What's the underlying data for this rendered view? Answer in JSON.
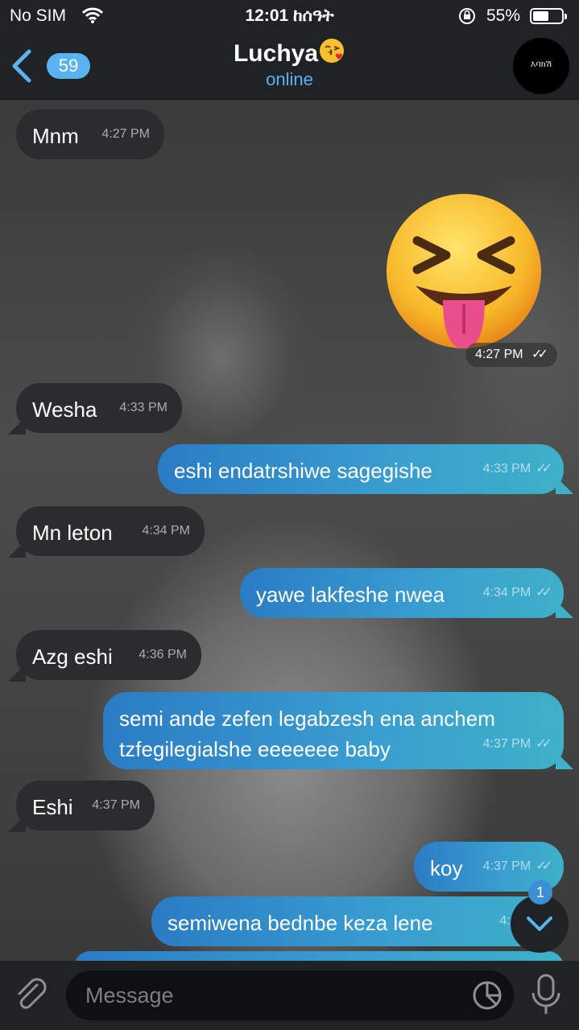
{
  "status_bar": {
    "carrier": "No SIM",
    "time": "12:01 ከሰዓት",
    "battery_percent": "55%",
    "battery_level": 0.55
  },
  "header": {
    "back_count": "59",
    "contact_name": "Luchya",
    "status": "online",
    "avatar_text": "እባክሽ"
  },
  "messages": [
    {
      "direction": "in",
      "text": "Mnm",
      "time": "4:27 PM"
    },
    {
      "direction": "out",
      "type": "sticker",
      "sticker": "squinting-face-with-tongue",
      "time": "4:27 PM",
      "read": true
    },
    {
      "direction": "in",
      "text": "Wesha",
      "time": "4:33 PM"
    },
    {
      "direction": "out",
      "text": "eshi endatrshiwe sagegishe",
      "time": "4:33 PM",
      "read": true
    },
    {
      "direction": "in",
      "text": "Mn leton",
      "time": "4:34 PM"
    },
    {
      "direction": "out",
      "text": "yawe lakfeshe nwea",
      "time": "4:34 PM",
      "read": true
    },
    {
      "direction": "in",
      "text": "Azg eshi",
      "time": "4:36 PM"
    },
    {
      "direction": "out",
      "text": "semi ande zefen legabzesh ena anchem\ntzfegilegialshe eeeeeee baby",
      "time": "4:37 PM",
      "read": true
    },
    {
      "direction": "in",
      "text": "Eshi",
      "time": "4:37 PM"
    },
    {
      "direction": "out",
      "text": "koy",
      "time": "4:37 PM",
      "read": true
    },
    {
      "direction": "out",
      "text": "semiwena bednbe keza lene",
      "time": "4:39 PM",
      "read": false
    }
  ],
  "scroll_down": {
    "unread": "1"
  },
  "composer": {
    "placeholder": "Message"
  },
  "icons": {
    "back": "chevron-left-icon",
    "wifi": "wifi-icon",
    "lock": "orientation-lock-icon",
    "attach": "paperclip-icon",
    "sticker": "sticker-icon",
    "mic": "microphone-icon",
    "scroll": "chevron-down-icon"
  },
  "colors": {
    "accent": "#59b3f0",
    "outgoing_start": "#2a7cc4",
    "outgoing_end": "#3eb0c8",
    "incoming": "#2b2c2e",
    "bar": "#202326"
  }
}
